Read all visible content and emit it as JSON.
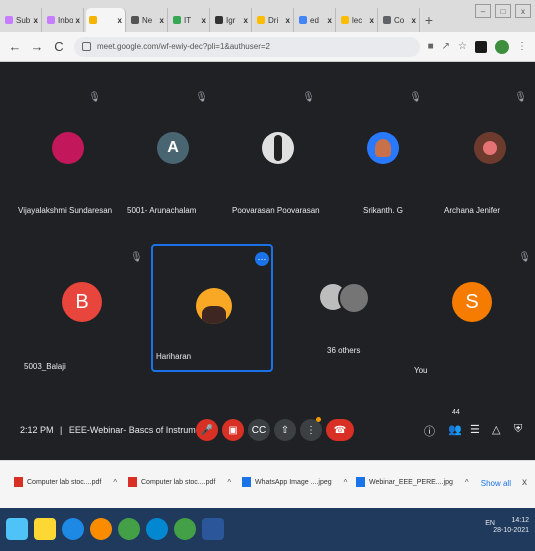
{
  "browser": {
    "tabs": [
      {
        "label": "Sub",
        "color": "#c77dff"
      },
      {
        "label": "Inbo",
        "color": "#c77dff"
      },
      {
        "label": "",
        "color": "#f4b400",
        "active": true
      },
      {
        "label": "Ne",
        "color": "#555555"
      },
      {
        "label": "IT",
        "color": "#34a853"
      },
      {
        "label": "Igr",
        "color": "#333333"
      },
      {
        "label": "Dri",
        "color": "#fbbc04"
      },
      {
        "label": "ed",
        "color": "#4285f4"
      },
      {
        "label": "lec",
        "color": "#fbbc04"
      },
      {
        "label": "Co",
        "color": "#5f6368"
      }
    ],
    "tab_close": "x",
    "new_tab": "+",
    "window_controls": {
      "minimize": "–",
      "maximize": "□",
      "close": "x"
    },
    "url": "meet.google.com/wf-ewiy-dec?pli=1&authuser=2"
  },
  "meet": {
    "participants_row1": [
      {
        "name": "Vijayalakshmi Sundaresan",
        "initial": "",
        "avatar_color": "#c2185b"
      },
      {
        "name": "5001- Arunachalam",
        "initial": "A",
        "avatar_color": "#4a6572"
      },
      {
        "name": "Poovarasan Poovarasan",
        "initial": "",
        "avatar_color": "#e0e0e0"
      },
      {
        "name": "Srikanth. G",
        "initial": "",
        "avatar_color": "#2979ff"
      },
      {
        "name": "Archana Jenifer",
        "initial": "",
        "avatar_color": "#6d3b2e"
      }
    ],
    "participants_row2": [
      {
        "name": "5003_Balaji",
        "initial": "B",
        "avatar_color": "#e8453c"
      },
      {
        "name": "Hariharan",
        "initial": "",
        "avatar_color": "#f9a825"
      },
      {
        "name": "36 others",
        "initial": "",
        "avatar_color": "#9e9e9e"
      },
      {
        "name": "You",
        "initial": "S",
        "avatar_color": "#f57c00"
      }
    ],
    "pinned_more": "⋯",
    "time": "2:12 PM",
    "separator": "|",
    "meeting_title": "EEE-Webinar- Bascs of Instrum...",
    "participant_count": "44",
    "colors": {
      "background": "#202124",
      "accent": "#1a73e8",
      "danger": "#d93025"
    }
  },
  "downloads": [
    {
      "label": "Computer lab stoc....pdf",
      "type": "pdf"
    },
    {
      "label": "Computer lab stoc....pdf",
      "type": "pdf"
    },
    {
      "label": "WhatsApp Image ....jpeg",
      "type": "image"
    },
    {
      "label": "Webinar_EEE_PERE....jpg",
      "type": "image"
    }
  ],
  "downloads_show_all": "Show all",
  "downloads_close": "x",
  "download_chevron": "^",
  "taskbar": {
    "time": "14:12",
    "date": "28-10-2021",
    "tray": "EN",
    "icons": [
      "windows",
      "explorer",
      "ie",
      "vlc",
      "chrome",
      "edge",
      "chrome",
      "word"
    ]
  }
}
